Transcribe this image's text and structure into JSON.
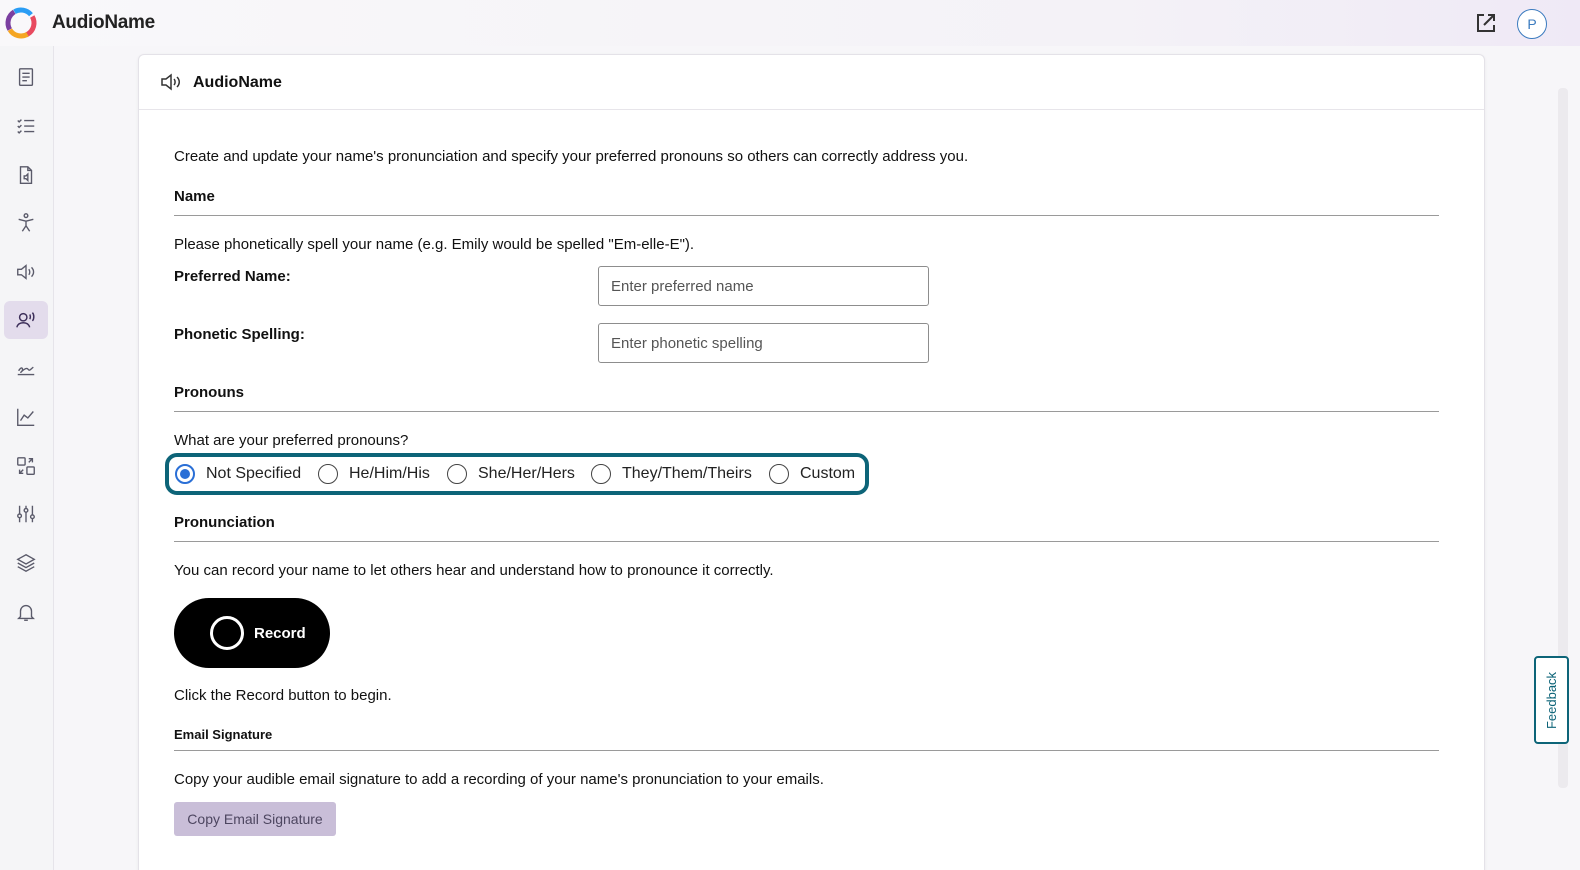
{
  "app": {
    "title": "AudioName",
    "avatar_initial": "P"
  },
  "sidebar": {
    "items": [
      {
        "icon": "document-icon",
        "active": false
      },
      {
        "icon": "checklist-icon",
        "active": false
      },
      {
        "icon": "audio-file-icon",
        "active": false
      },
      {
        "icon": "accessibility-icon",
        "active": false
      },
      {
        "icon": "speaker-icon",
        "active": false
      },
      {
        "icon": "voice-person-icon",
        "active": true
      },
      {
        "icon": "sign-icon",
        "active": false
      },
      {
        "icon": "analytics-icon",
        "active": false
      },
      {
        "icon": "transfer-icon",
        "active": false
      },
      {
        "icon": "sliders-icon",
        "active": false
      },
      {
        "icon": "layers-icon",
        "active": false
      },
      {
        "icon": "bell-icon",
        "active": false
      }
    ]
  },
  "card": {
    "title": "AudioName",
    "intro": "Create and update your name's pronunciation and specify your preferred pronouns so others can correctly address you.",
    "name_section": {
      "title": "Name",
      "help": "Please phonetically spell your name (e.g. Emily would be spelled \"Em-elle-E\").",
      "preferred_label": "Preferred Name:",
      "preferred_placeholder": "Enter preferred name",
      "preferred_value": "",
      "phonetic_label": "Phonetic Spelling:",
      "phonetic_placeholder": "Enter phonetic spelling",
      "phonetic_value": ""
    },
    "pronouns_section": {
      "title": "Pronouns",
      "question": "What are your preferred pronouns?",
      "options": [
        "Not Specified",
        "He/Him/His",
        "She/Her/Hers",
        "They/Them/Theirs",
        "Custom"
      ],
      "selected": "Not Specified"
    },
    "pronunciation_section": {
      "title": "Pronunciation",
      "help": "You can record your name to let others hear and understand how to pronounce it correctly.",
      "record_label": "Record",
      "hint": "Click the Record button to begin."
    },
    "email_section": {
      "title": "Email Signature",
      "help": "Copy your audible email signature to add a recording of your name's pronunciation to your emails.",
      "copy_label": "Copy Email Signature"
    }
  },
  "feedback_label": "Feedback",
  "colors": {
    "accent": "#0d6478",
    "radio_selected": "#2a6fd6",
    "sidebar_active": "#e3dcec",
    "copy_button": "#c9bed8"
  }
}
